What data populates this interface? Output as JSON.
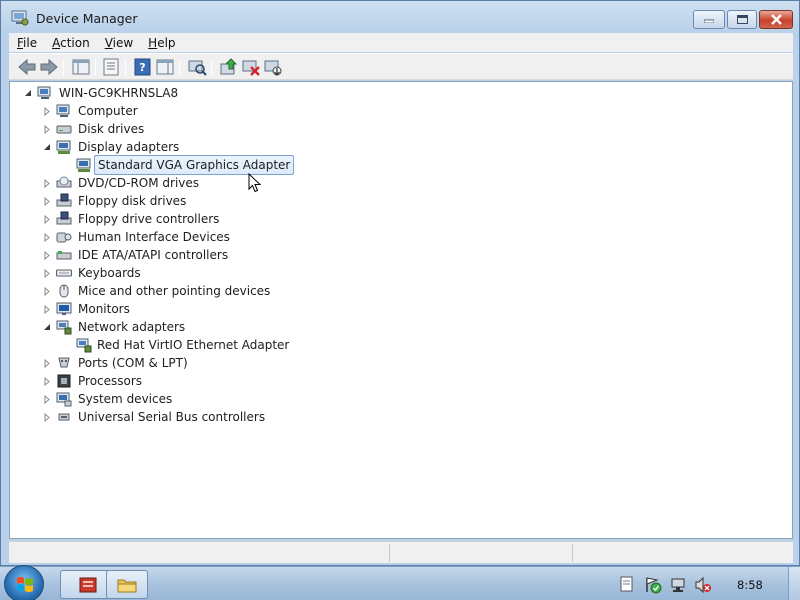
{
  "window": {
    "title": "Device Manager"
  },
  "menu": [
    {
      "accel": "F",
      "rest": "ile"
    },
    {
      "accel": "A",
      "rest": "ction"
    },
    {
      "accel": "V",
      "rest": "iew"
    },
    {
      "accel": "H",
      "rest": "elp"
    }
  ],
  "tree": {
    "root": "WIN-GC9KHRNSLA8",
    "categories": [
      {
        "label": "Computer",
        "expanded": false,
        "icon": "computer-icon"
      },
      {
        "label": "Disk drives",
        "expanded": false,
        "icon": "disk-drive-icon"
      },
      {
        "label": "Display adapters",
        "expanded": true,
        "icon": "display-adapter-icon",
        "children": [
          {
            "label": "Standard VGA Graphics Adapter",
            "selected": true
          }
        ]
      },
      {
        "label": "DVD/CD-ROM drives",
        "expanded": false,
        "icon": "dvd-drive-icon"
      },
      {
        "label": "Floppy disk drives",
        "expanded": false,
        "icon": "floppy-icon"
      },
      {
        "label": "Floppy drive controllers",
        "expanded": false,
        "icon": "floppy-controller-icon"
      },
      {
        "label": "Human Interface Devices",
        "expanded": false,
        "icon": "hid-icon"
      },
      {
        "label": "IDE ATA/ATAPI controllers",
        "expanded": false,
        "icon": "ide-controller-icon"
      },
      {
        "label": "Keyboards",
        "expanded": false,
        "icon": "keyboard-icon"
      },
      {
        "label": "Mice and other pointing devices",
        "expanded": false,
        "icon": "mouse-icon"
      },
      {
        "label": "Monitors",
        "expanded": false,
        "icon": "monitor-icon"
      },
      {
        "label": "Network adapters",
        "expanded": true,
        "icon": "network-adapter-icon",
        "children": [
          {
            "label": "Red Hat VirtIO Ethernet Adapter",
            "selected": false
          }
        ]
      },
      {
        "label": "Ports (COM & LPT)",
        "expanded": false,
        "icon": "ports-icon"
      },
      {
        "label": "Processors",
        "expanded": false,
        "icon": "processor-icon"
      },
      {
        "label": "System devices",
        "expanded": false,
        "icon": "system-devices-icon"
      },
      {
        "label": "Universal Serial Bus controllers",
        "expanded": false,
        "icon": "usb-icon"
      }
    ]
  },
  "taskbar": {
    "clock": "8:58"
  },
  "colors": {
    "selection_border": "#7da2ce",
    "selection_fill": "#dcebfc",
    "close_button": "#c7412b"
  }
}
